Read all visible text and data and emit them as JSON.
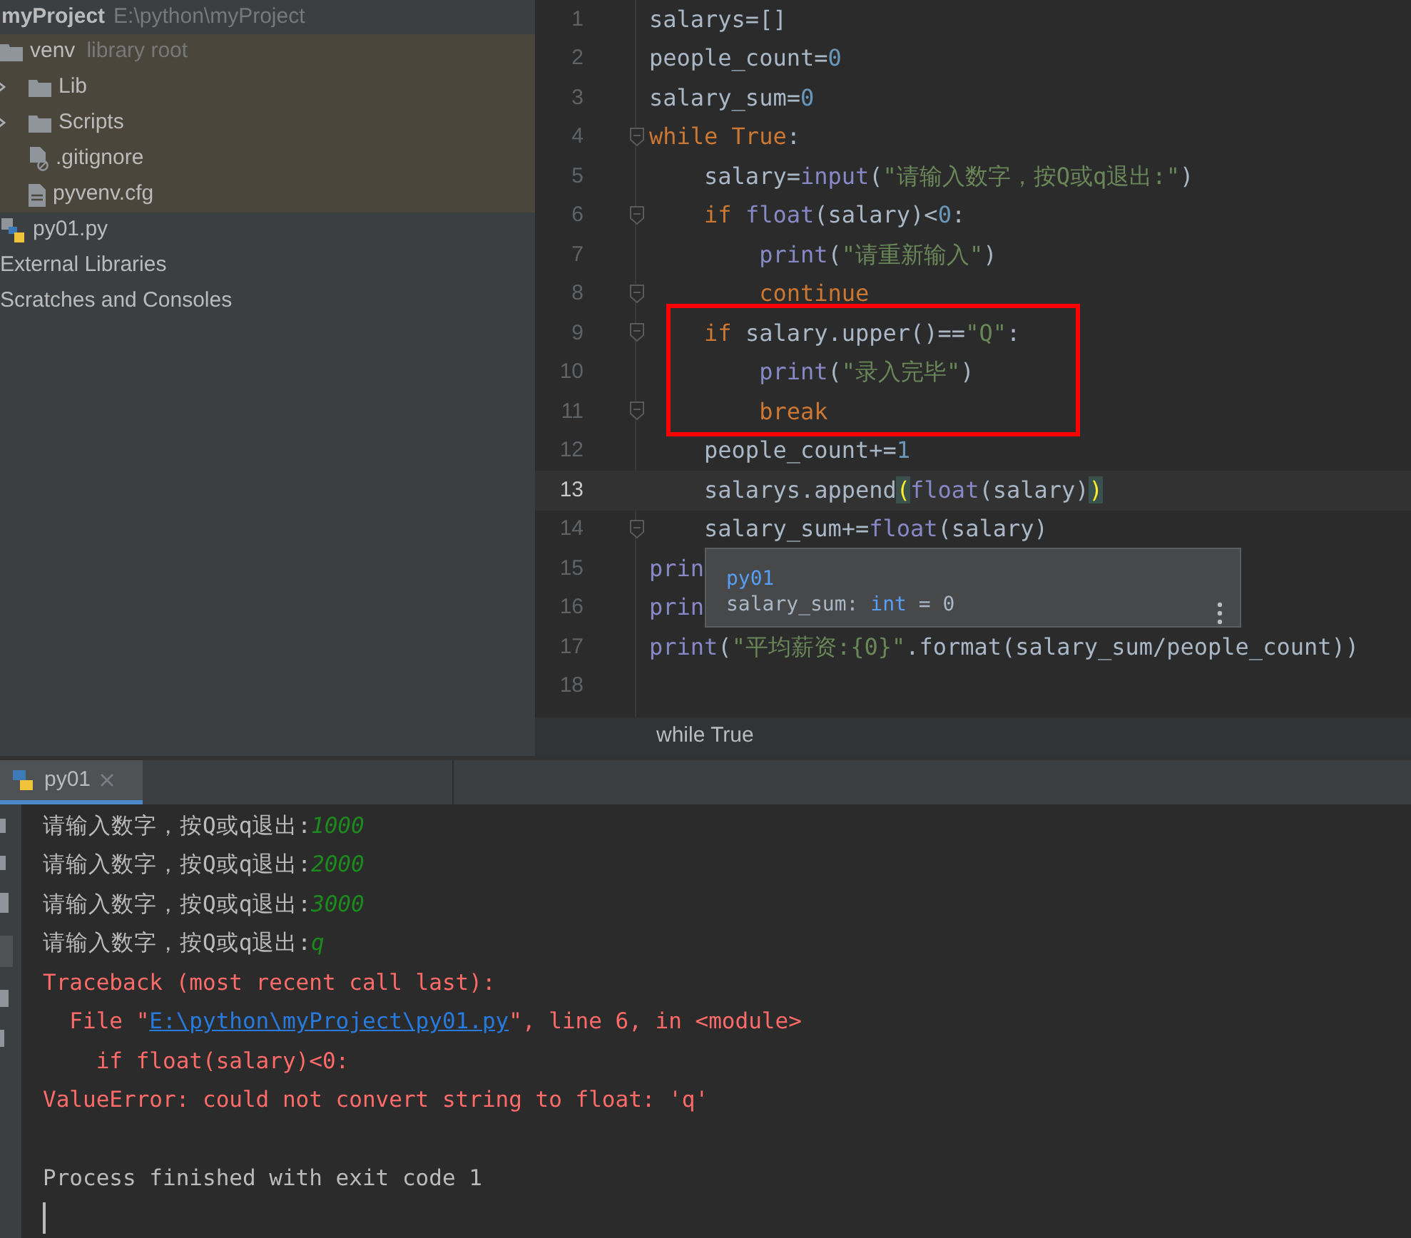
{
  "project": {
    "name": "myProject",
    "path": "E:\\python\\myProject",
    "items": [
      {
        "name": "venv",
        "note": "library root",
        "kind": "folder",
        "highlighted": true,
        "children": [
          {
            "name": "Lib",
            "kind": "folder",
            "expanded": false,
            "highlighted": true
          },
          {
            "name": "Scripts",
            "kind": "folder",
            "expanded": false,
            "highlighted": true
          },
          {
            "name": ".gitignore",
            "kind": "ignored",
            "highlighted": true
          },
          {
            "name": "pyvenv.cfg",
            "kind": "file",
            "highlighted": true
          }
        ]
      },
      {
        "name": "py01.py",
        "kind": "python",
        "highlighted": false
      },
      {
        "name": "External Libraries",
        "kind": "plain",
        "highlighted": false
      },
      {
        "name": "Scratches and Consoles",
        "kind": "plain",
        "highlighted": false
      }
    ]
  },
  "editor": {
    "lines": [
      {
        "number": "1",
        "current": false,
        "fold": false,
        "tokens": [
          {
            "t": "salarys=[]",
            "kind": "plain"
          }
        ]
      },
      {
        "number": "2",
        "current": false,
        "fold": false,
        "tokens": [
          {
            "t": "people_count=",
            "kind": "plain"
          },
          {
            "t": "0",
            "kind": "number"
          }
        ]
      },
      {
        "number": "3",
        "current": false,
        "fold": false,
        "tokens": [
          {
            "t": "salary_sum=",
            "kind": "plain"
          },
          {
            "t": "0",
            "kind": "number"
          }
        ]
      },
      {
        "number": "4",
        "current": false,
        "fold": true,
        "tokens": [
          {
            "t": "while True",
            "kind": "keyword"
          },
          {
            "t": ":",
            "kind": "plain"
          }
        ]
      },
      {
        "number": "5",
        "current": false,
        "fold": false,
        "tokens": [
          {
            "t": "    salary=",
            "kind": "plain"
          },
          {
            "t": "input",
            "kind": "builtin"
          },
          {
            "t": "(",
            "kind": "plain"
          },
          {
            "t": "\"请输入数字，按Q或q退出:\"",
            "kind": "string"
          },
          {
            "t": ")",
            "kind": "plain"
          }
        ]
      },
      {
        "number": "6",
        "current": false,
        "fold": true,
        "tokens": [
          {
            "t": "    if ",
            "kind": "keyword"
          },
          {
            "t": "float",
            "kind": "builtin"
          },
          {
            "t": "(salary)<",
            "kind": "plain"
          },
          {
            "t": "0",
            "kind": "number"
          },
          {
            "t": ":",
            "kind": "plain"
          }
        ]
      },
      {
        "number": "7",
        "current": false,
        "fold": false,
        "tokens": [
          {
            "t": "        print",
            "kind": "builtin"
          },
          {
            "t": "(",
            "kind": "plain"
          },
          {
            "t": "\"请重新输入\"",
            "kind": "string"
          },
          {
            "t": ")",
            "kind": "plain"
          }
        ]
      },
      {
        "number": "8",
        "current": false,
        "fold": true,
        "tokens": [
          {
            "t": "        continue",
            "kind": "keyword"
          }
        ]
      },
      {
        "number": "9",
        "current": false,
        "fold": true,
        "tokens": [
          {
            "t": "    if ",
            "kind": "keyword"
          },
          {
            "t": "salary.upper()==",
            "kind": "plain"
          },
          {
            "t": "\"Q\"",
            "kind": "string"
          },
          {
            "t": ":",
            "kind": "plain"
          }
        ]
      },
      {
        "number": "10",
        "current": false,
        "fold": false,
        "tokens": [
          {
            "t": "        print",
            "kind": "builtin"
          },
          {
            "t": "(",
            "kind": "plain"
          },
          {
            "t": "\"录入完毕\"",
            "kind": "string"
          },
          {
            "t": ")",
            "kind": "plain"
          }
        ]
      },
      {
        "number": "11",
        "current": false,
        "fold": true,
        "tokens": [
          {
            "t": "        break",
            "kind": "keyword"
          }
        ]
      },
      {
        "number": "12",
        "current": false,
        "fold": false,
        "tokens": [
          {
            "t": "    people_count+=",
            "kind": "plain"
          },
          {
            "t": "1",
            "kind": "number"
          }
        ]
      },
      {
        "number": "13",
        "current": true,
        "fold": false,
        "tokens": [
          {
            "t": "    salarys.append",
            "kind": "plain"
          },
          {
            "t": "(",
            "kind": "brace"
          },
          {
            "t": "float",
            "kind": "builtin"
          },
          {
            "t": "(salary)",
            "kind": "plain"
          },
          {
            "t": ")",
            "kind": "brace"
          }
        ]
      },
      {
        "number": "14",
        "current": false,
        "fold": true,
        "tokens": [
          {
            "t": "    salary_sum+=",
            "kind": "plain"
          },
          {
            "t": "float",
            "kind": "builtin"
          },
          {
            "t": "(salary)",
            "kind": "plain"
          }
        ]
      },
      {
        "number": "15",
        "current": false,
        "fold": false,
        "tokens": [
          {
            "t": "prin",
            "kind": "builtin"
          }
        ]
      },
      {
        "number": "16",
        "current": false,
        "fold": false,
        "tokens": [
          {
            "t": "prin",
            "kind": "builtin"
          }
        ]
      },
      {
        "number": "17",
        "current": false,
        "fold": false,
        "tokens": [
          {
            "t": "print",
            "kind": "builtin"
          },
          {
            "t": "(",
            "kind": "plain"
          },
          {
            "t": "\"平均薪资:{0}\"",
            "kind": "string"
          },
          {
            "t": ".format(salary_sum/people_count))",
            "kind": "plain"
          }
        ]
      },
      {
        "number": "18",
        "current": false,
        "fold": false
      }
    ],
    "tooltip": {
      "title": "py01",
      "tokens": [
        {
          "t": "salary_sum: ",
          "kind": "plain"
        },
        {
          "t": "int",
          "kind": "type"
        },
        {
          "t": " = 0",
          "kind": "plain"
        }
      ]
    },
    "breadcrumb": "while True"
  },
  "run": {
    "tab": {
      "label": "py01",
      "selected": true
    },
    "lines": [
      {
        "kind": "prompt",
        "text": "请输入数字，按Q或q退出:",
        "input": "1000"
      },
      {
        "kind": "prompt",
        "text": "请输入数字，按Q或q退出:",
        "input": "2000"
      },
      {
        "kind": "prompt",
        "text": "请输入数字，按Q或q退出:",
        "input": "3000"
      },
      {
        "kind": "prompt",
        "text": "请输入数字，按Q或q退出:",
        "input": "q"
      },
      {
        "kind": "error",
        "text": "Traceback (most recent call last):"
      },
      {
        "kind": "file",
        "before": "  File \"",
        "link": "E:\\python\\myProject\\py01.py",
        "after": "\", line 6, in <module>"
      },
      {
        "kind": "error",
        "text": "    if float(salary)<0:"
      },
      {
        "kind": "error",
        "text": "ValueError: could not convert string to float: 'q'"
      },
      {
        "kind": "blank"
      },
      {
        "kind": "info",
        "text": "Process finished with exit code 1"
      },
      {
        "kind": "cursor"
      }
    ]
  }
}
